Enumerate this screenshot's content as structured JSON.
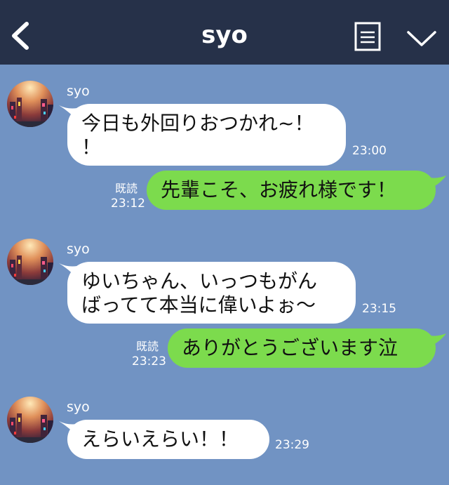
{
  "header": {
    "title": "syo",
    "back_icon": "chevron-left-icon",
    "menu_icon": "list-icon",
    "expand_icon": "chevron-down-icon",
    "bar_color": "#263149"
  },
  "chat": {
    "background_color": "#7193c3",
    "incoming_bubble_color": "#ffffff",
    "outgoing_bubble_color": "#7cdb4d",
    "messages": [
      {
        "direction": "incoming",
        "sender": "syo",
        "lines": [
          "今日も外回りおつかれ~！",
          "！"
        ],
        "time": "23:00"
      },
      {
        "direction": "outgoing",
        "read_label": "既読",
        "lines": [
          "先輩こそ、お疲れ様です！"
        ],
        "time": "23:12"
      },
      {
        "direction": "incoming",
        "sender": "syo",
        "lines": [
          "ゆいちゃん、いっつもがん",
          "ばってて本当に偉いよぉ〜"
        ],
        "time": "23:15"
      },
      {
        "direction": "outgoing",
        "read_label": "既読",
        "lines": [
          "ありがとうございます泣"
        ],
        "time": "23:23"
      },
      {
        "direction": "incoming",
        "sender": "syo",
        "lines": [
          "えらいえらい！！"
        ],
        "time": "23:29"
      }
    ]
  }
}
